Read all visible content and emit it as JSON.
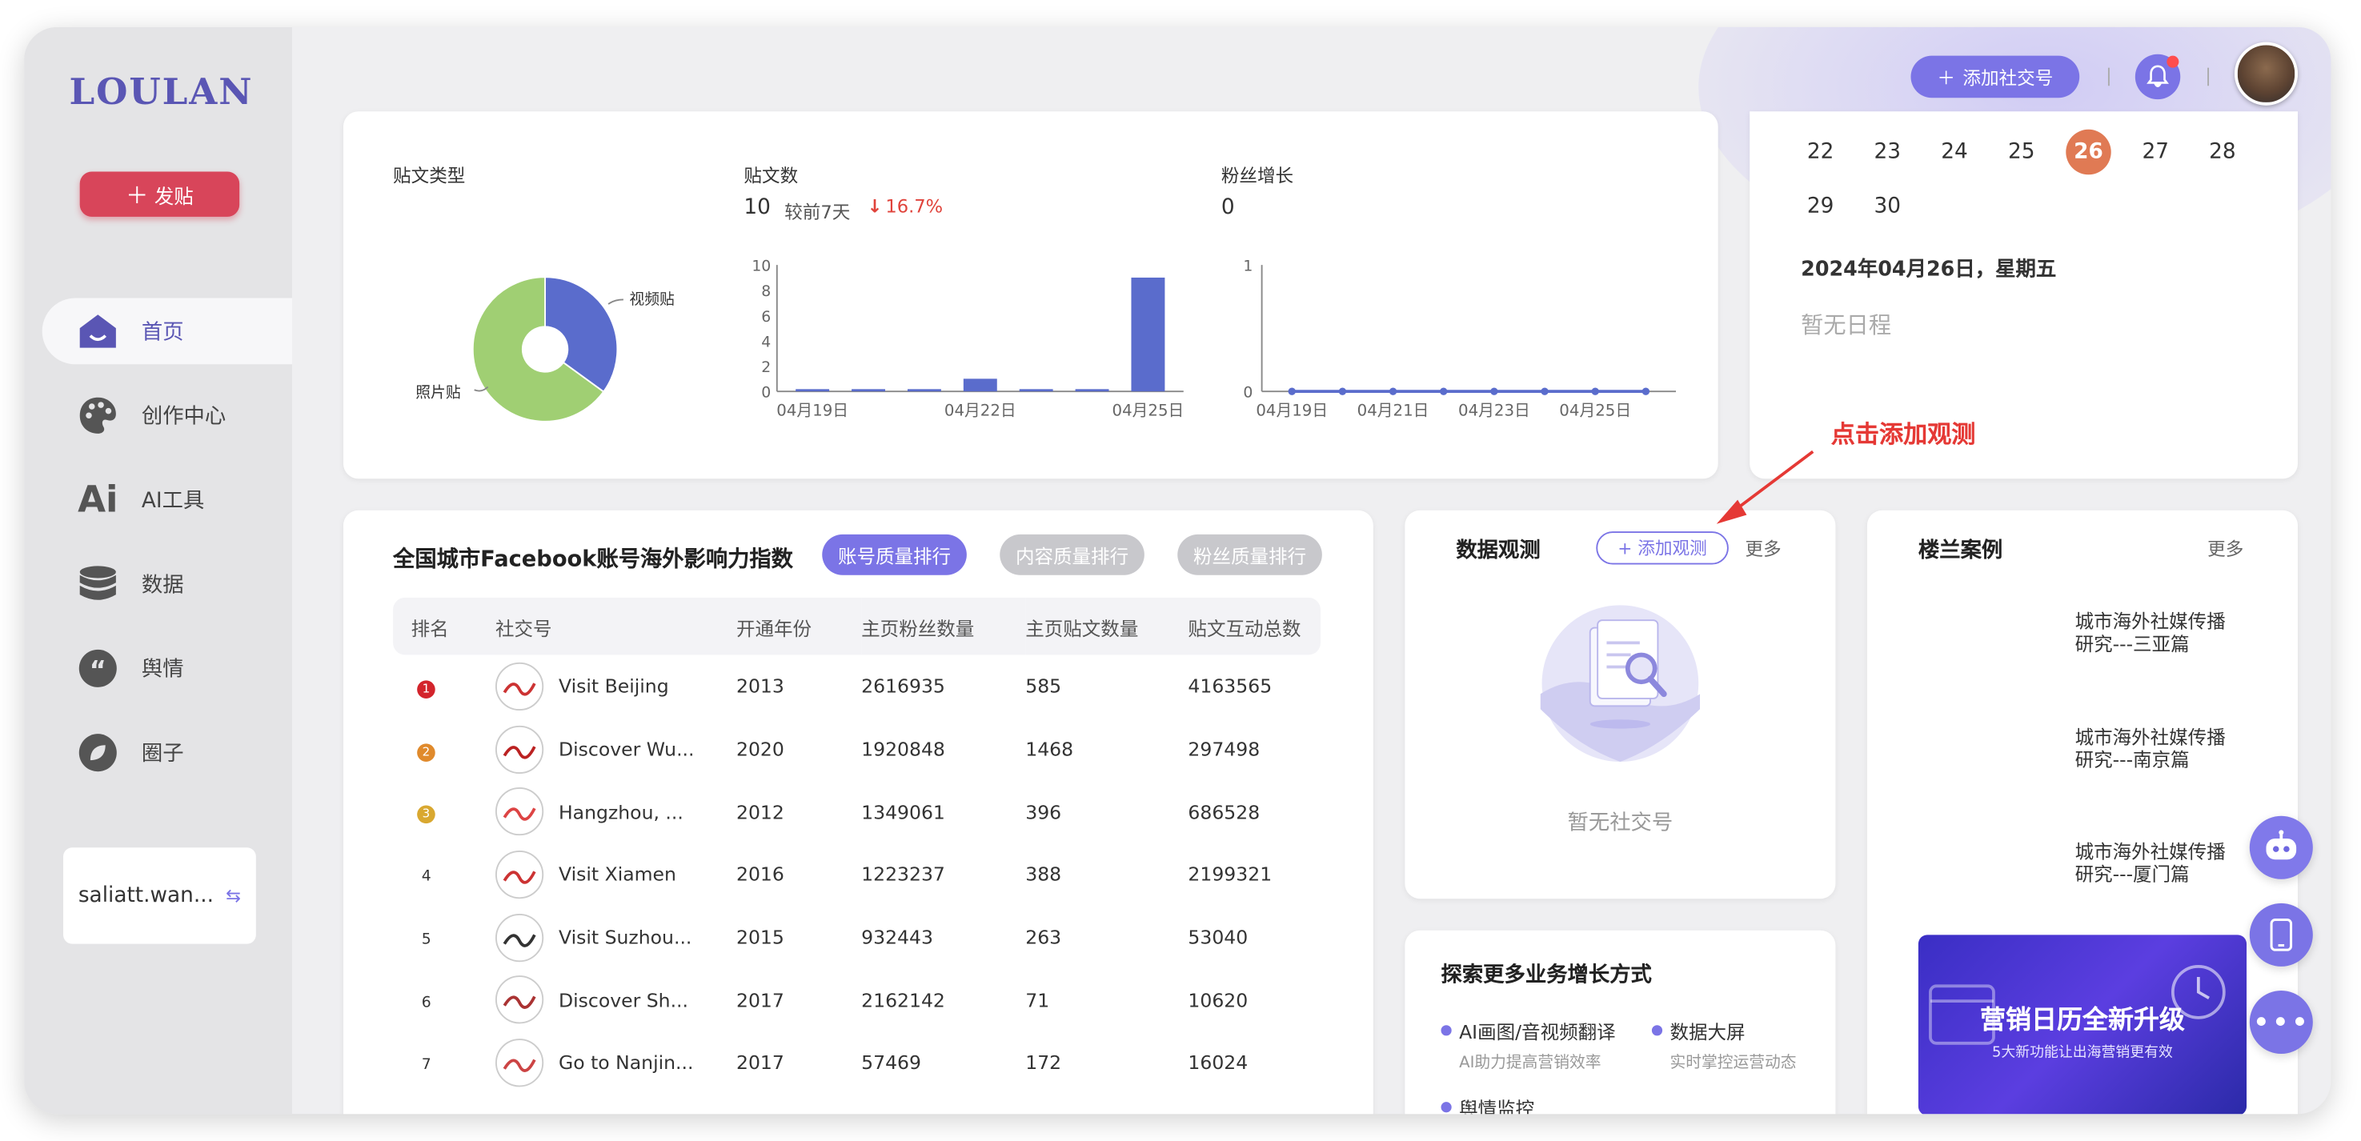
{
  "app": {
    "logo": "LOULAN"
  },
  "sidebar": {
    "post_button": "发贴",
    "items": [
      {
        "label": "首页",
        "icon": "home-icon",
        "active": true
      },
      {
        "label": "创作中心",
        "icon": "palette-icon",
        "active": false
      },
      {
        "label": "AI工具",
        "icon": "ai-icon",
        "active": false
      },
      {
        "label": "数据",
        "icon": "database-icon",
        "active": false
      },
      {
        "label": "舆情",
        "icon": "quote-icon",
        "active": false
      },
      {
        "label": "圈子",
        "icon": "leaf-icon",
        "active": false
      }
    ],
    "user": "saliatt.wan..."
  },
  "header": {
    "add_account": "添加社交号"
  },
  "stats": {
    "post_type": {
      "title": "贴文类型",
      "video_label": "视频贴",
      "photo_label": "照片贴"
    },
    "post_count": {
      "title": "贴文数",
      "value": "10",
      "compare": "较前7天",
      "change": "16.7%"
    },
    "fans": {
      "title": "粉丝增长",
      "value": "0"
    }
  },
  "chart_data": [
    {
      "type": "pie",
      "title": "贴文类型",
      "categories": [
        "视频贴",
        "照片贴"
      ],
      "values": [
        35,
        65
      ],
      "colors": [
        "#5a6ccc",
        "#a0cf73"
      ]
    },
    {
      "type": "bar",
      "title": "贴文数",
      "categories": [
        "04月19日",
        "04月20日",
        "04月21日",
        "04月22日",
        "04月23日",
        "04月24日",
        "04月25日"
      ],
      "x_tick_labels": [
        "04月19日",
        "04月22日",
        "04月25日"
      ],
      "values": [
        0,
        0,
        0,
        1,
        0,
        0,
        9
      ],
      "yticks": [
        0,
        2,
        4,
        6,
        8,
        10
      ],
      "ylim": [
        0,
        10
      ],
      "color": "#5a6ccc"
    },
    {
      "type": "line",
      "title": "粉丝增长",
      "categories": [
        "04月19日",
        "04月20日",
        "04月21日",
        "04月22日",
        "04月23日",
        "04月24日",
        "04月25日",
        "04月26日"
      ],
      "x_tick_labels": [
        "04月19日",
        "04月21日",
        "04月23日",
        "04月25日"
      ],
      "values": [
        0,
        0,
        0,
        0,
        0,
        0,
        0,
        0
      ],
      "yticks": [
        0,
        1
      ],
      "ylim": [
        0,
        1
      ],
      "color": "#5a6ccc"
    }
  ],
  "calendar": {
    "row1": [
      "22",
      "23",
      "24",
      "25",
      "26",
      "27",
      "28"
    ],
    "row2": [
      "29",
      "30"
    ],
    "today": "26",
    "date_text": "2024年04月26日，星期五",
    "empty": "暂无日程"
  },
  "annotation": {
    "text": "点击添加观测"
  },
  "ranking": {
    "title": "全国城市Facebook账号海外影响力指数",
    "tabs": [
      "账号质量排行",
      "内容质量排行",
      "粉丝质量排行"
    ],
    "columns": [
      "排名",
      "社交号",
      "开通年份",
      "主页粉丝数量",
      "主页贴文数量",
      "贴文互动总数"
    ],
    "rows": [
      {
        "rank": "1",
        "name": "Visit Beijing",
        "year": "2013",
        "fans": "2616935",
        "posts": "585",
        "interactions": "4163565"
      },
      {
        "rank": "2",
        "name": "Discover Wu...",
        "year": "2020",
        "fans": "1920848",
        "posts": "1468",
        "interactions": "297498"
      },
      {
        "rank": "3",
        "name": "Hangzhou, ...",
        "year": "2012",
        "fans": "1349061",
        "posts": "396",
        "interactions": "686528"
      },
      {
        "rank": "4",
        "name": "Visit Xiamen",
        "year": "2016",
        "fans": "1223237",
        "posts": "388",
        "interactions": "2199321"
      },
      {
        "rank": "5",
        "name": "Visit Suzhou...",
        "year": "2015",
        "fans": "932443",
        "posts": "263",
        "interactions": "53040"
      },
      {
        "rank": "6",
        "name": "Discover Sh...",
        "year": "2017",
        "fans": "2162142",
        "posts": "71",
        "interactions": "10620"
      },
      {
        "rank": "7",
        "name": "Go to Nanjin...",
        "year": "2017",
        "fans": "57469",
        "posts": "172",
        "interactions": "16024"
      }
    ]
  },
  "observe": {
    "title": "数据观测",
    "add": "+ 添加观测",
    "more": "更多",
    "empty": "暂无社交号"
  },
  "explore": {
    "title": "探索更多业务增长方式",
    "items": [
      {
        "title": "AI画图/音视频翻译",
        "sub": "AI助力提高营销效率"
      },
      {
        "title": "数据大屏",
        "sub": "实时掌控运营动态"
      },
      {
        "title": "舆情监控",
        "sub": ""
      }
    ]
  },
  "cases": {
    "title": "楼兰案例",
    "more": "更多",
    "thumb_title": "城市海外社媒传播研究",
    "items": [
      "城市海外社媒传播研究---三亚篇",
      "城市海外社媒传播研究---南京篇",
      "城市海外社媒传播研究---厦门篇"
    ],
    "banner_title": "营销日历全新升级",
    "banner_sub": "5大新功能让出海营销更有效"
  }
}
